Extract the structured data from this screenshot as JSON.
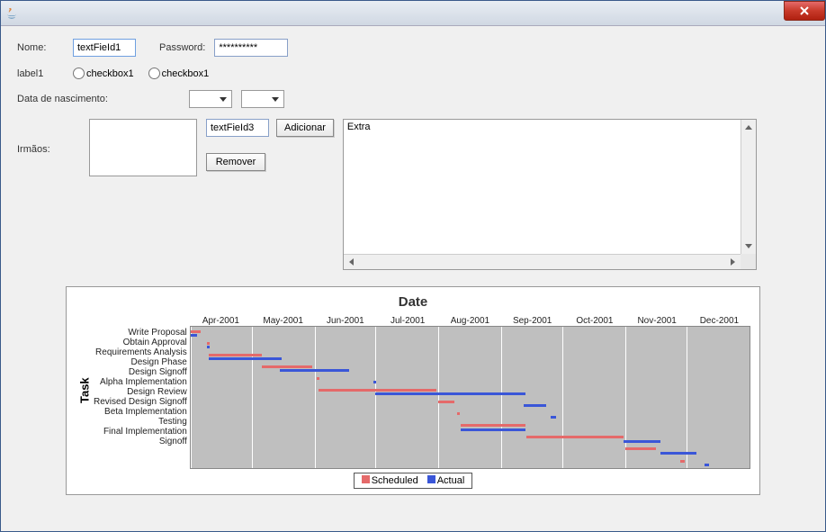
{
  "titlebar": {
    "title": ""
  },
  "form": {
    "nome_label": "Nome:",
    "nome_value": "textFieId1",
    "password_label": "Password:",
    "password_value": "**********",
    "label1": "label1",
    "checkbox1_label": "checkbox1",
    "checkbox2_label": "checkbox1",
    "dob_label": "Data de nascimento:",
    "irmaos_label": "Irmãos:",
    "tf3_value": "textFieId3",
    "btn_adicionar": "Adicionar",
    "btn_remover": "Remover",
    "extra_text": "Extra"
  },
  "chart_data": {
    "type": "bar",
    "title": "Date",
    "xlabel": "",
    "ylabel": "Task",
    "categories": [
      "Apr-2001",
      "May-2001",
      "Jun-2001",
      "Jul-2001",
      "Aug-2001",
      "Sep-2001",
      "Oct-2001",
      "Nov-2001",
      "Dec-2001"
    ],
    "x_domain": [
      "2001-04-01",
      "2002-01-01"
    ],
    "tasks": [
      "Write Proposal",
      "Obtain Approval",
      "Requirements Analysis",
      "Design Phase",
      "Design Signoff",
      "Alpha Implementation",
      "Design Review",
      "Revised Design Signoff",
      "Beta Implementation",
      "Testing",
      "Final Implementation",
      "Signoff"
    ],
    "series": [
      {
        "name": "Scheduled",
        "color": "#e56a6a",
        "intervals": [
          {
            "task": "Write Proposal",
            "start": "2001-04-01",
            "end": "2001-04-06"
          },
          {
            "task": "Obtain Approval",
            "start": "2001-04-09",
            "end": "2001-04-10"
          },
          {
            "task": "Requirements Analysis",
            "start": "2001-04-10",
            "end": "2001-05-06"
          },
          {
            "task": "Design Phase",
            "start": "2001-05-06",
            "end": "2001-05-31"
          },
          {
            "task": "Design Signoff",
            "start": "2001-06-02",
            "end": "2001-06-03"
          },
          {
            "task": "Alpha Implementation",
            "start": "2001-06-03",
            "end": "2001-07-31"
          },
          {
            "task": "Design Review",
            "start": "2001-08-01",
            "end": "2001-08-09"
          },
          {
            "task": "Revised Design Signoff",
            "start": "2001-08-10",
            "end": "2001-08-11"
          },
          {
            "task": "Beta Implementation",
            "start": "2001-08-12",
            "end": "2001-09-13"
          },
          {
            "task": "Testing",
            "start": "2001-09-13",
            "end": "2001-10-31"
          },
          {
            "task": "Final Implementation",
            "start": "2001-11-01",
            "end": "2001-11-16"
          },
          {
            "task": "Signoff",
            "start": "2001-11-28",
            "end": "2001-11-30"
          }
        ]
      },
      {
        "name": "Actual",
        "color": "#3a56d8",
        "intervals": [
          {
            "task": "Write Proposal",
            "start": "2001-04-01",
            "end": "2001-04-04"
          },
          {
            "task": "Obtain Approval",
            "start": "2001-04-09",
            "end": "2001-04-10"
          },
          {
            "task": "Requirements Analysis",
            "start": "2001-04-10",
            "end": "2001-05-16"
          },
          {
            "task": "Design Phase",
            "start": "2001-05-15",
            "end": "2001-06-18"
          },
          {
            "task": "Design Signoff",
            "start": "2001-06-30",
            "end": "2001-07-01"
          },
          {
            "task": "Alpha Implementation",
            "start": "2001-07-01",
            "end": "2001-09-13"
          },
          {
            "task": "Design Review",
            "start": "2001-09-12",
            "end": "2001-09-23"
          },
          {
            "task": "Revised Design Signoff",
            "start": "2001-09-25",
            "end": "2001-09-28"
          },
          {
            "task": "Beta Implementation",
            "start": "2001-08-12",
            "end": "2001-09-13"
          },
          {
            "task": "Testing",
            "start": "2001-10-31",
            "end": "2001-11-18"
          },
          {
            "task": "Final Implementation",
            "start": "2001-11-18",
            "end": "2001-12-06"
          },
          {
            "task": "Signoff",
            "start": "2001-12-10",
            "end": "2001-12-12"
          }
        ]
      }
    ],
    "legend": {
      "scheduled": "Scheduled",
      "actual": "Actual"
    }
  }
}
